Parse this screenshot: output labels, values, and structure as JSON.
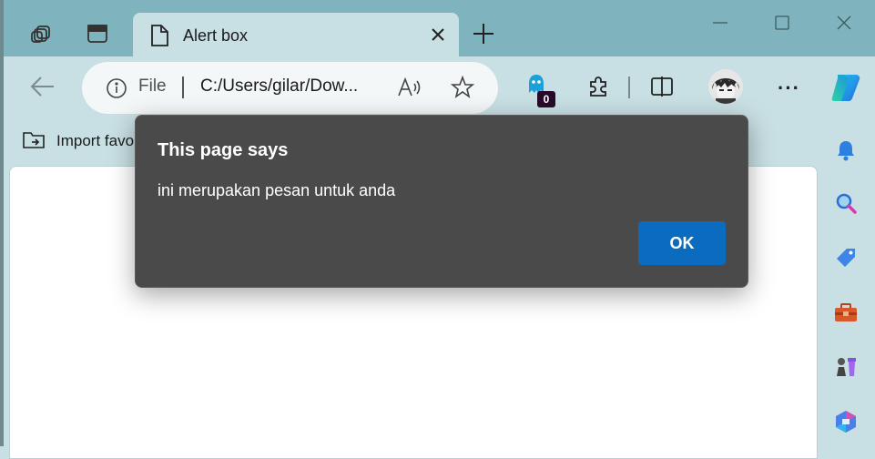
{
  "tab": {
    "title": "Alert box"
  },
  "address": {
    "scheme_label": "File",
    "url": "C:/Users/gilar/Dow..."
  },
  "extensions": {
    "ghost_badge": "0"
  },
  "favorites": {
    "import_label": "Import favo"
  },
  "dialog": {
    "title": "This page says",
    "message": "ini merupakan pesan untuk anda",
    "ok_label": "OK"
  },
  "colors": {
    "accent": "#0b6bbf",
    "tabstrip": "#7fb3bd",
    "toolbar": "#c8dfe3",
    "dialog_bg": "#4a4a4a"
  },
  "icons": [
    "workspaces-icon",
    "vertical-tabs-icon",
    "page-icon",
    "close-icon",
    "new-tab-icon",
    "minimize-icon",
    "maximize-icon",
    "window-close-icon",
    "back-icon",
    "info-icon",
    "read-aloud-icon",
    "favorite-star-icon",
    "ghostery-icon",
    "extensions-icon",
    "split-screen-icon",
    "profile-avatar",
    "more-icon",
    "copilot-icon",
    "import-favorites-icon",
    "notification-bell-icon",
    "search-icon",
    "shopping-tag-icon",
    "tools-icon",
    "games-icon",
    "office-icon"
  ]
}
